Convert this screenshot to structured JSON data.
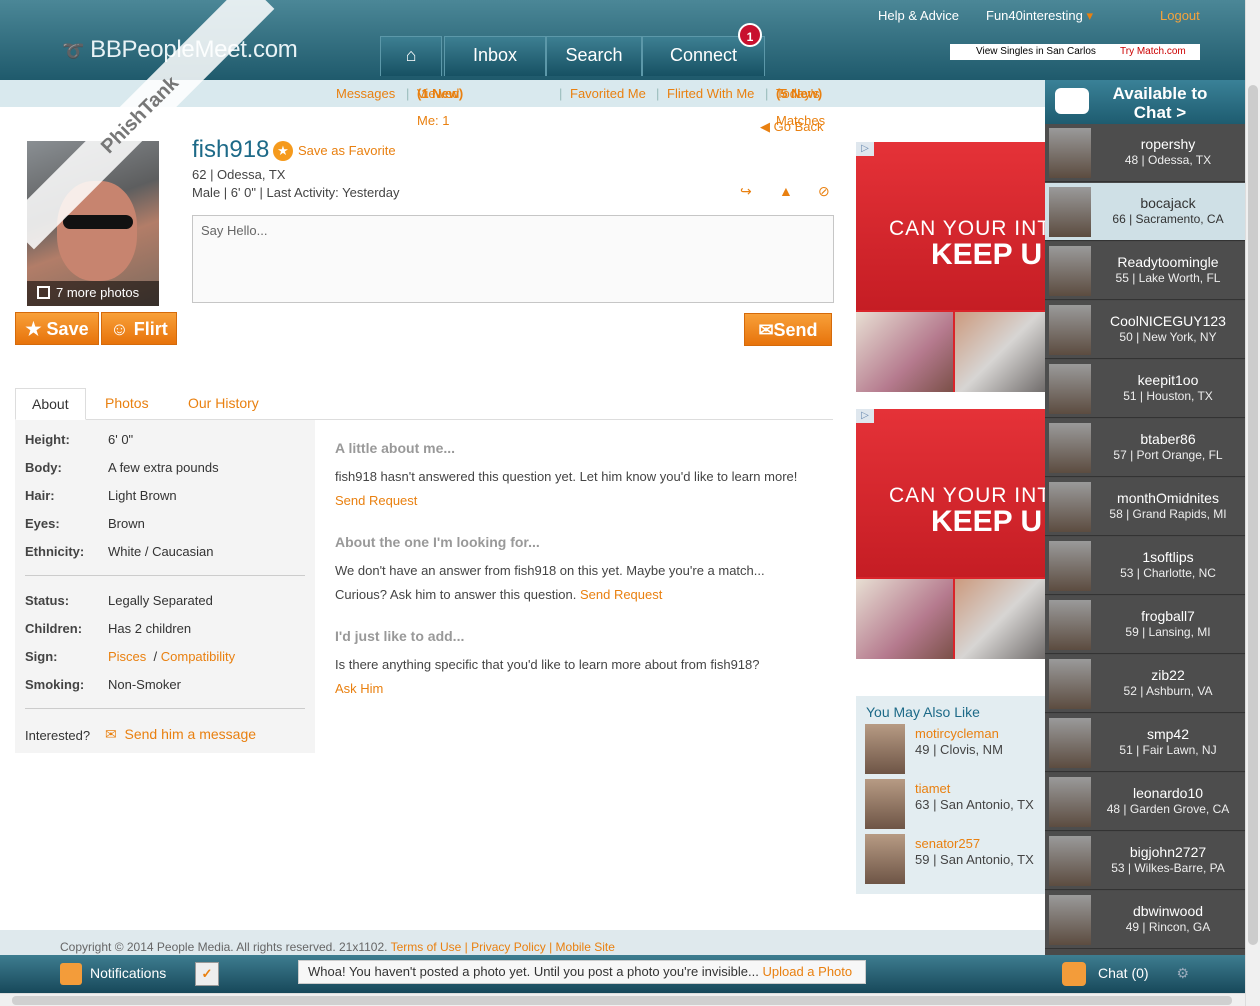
{
  "header": {
    "logo": "BBPeopleMeet.com",
    "nav": [
      "Inbox",
      "Search",
      "Connect"
    ],
    "connect_badge": "1",
    "help": "Help & Advice",
    "fun": "Fun40interesting",
    "logout": "Logout",
    "promo_left": "View Singles in San Carlos",
    "promo_right": "Try Match.com"
  },
  "subnav": {
    "messages": "Messages",
    "viewed": "Viewed Me: 1",
    "viewed_new": "(1 New)",
    "favorited": "Favorited Me",
    "flirted": "Flirted With Me",
    "matches": "Today's Matches",
    "matches_new": "(5 New)"
  },
  "profile": {
    "username": "fish918",
    "save_fav": "Save as Favorite",
    "location": "62 | Odessa, TX",
    "stats": "Male | 6' 0\" | Last Activity: Yesterday",
    "more_photos": "7 more photos",
    "save_btn": "Save",
    "flirt_btn": "Flirt",
    "send_btn": "Send",
    "go_back": "Go Back",
    "say_hello": "Say Hello..."
  },
  "tabs": [
    "About",
    "Photos",
    "Our History"
  ],
  "about": {
    "rows": [
      {
        "label": "Height:",
        "value": "6' 0\""
      },
      {
        "label": "Body:",
        "value": "A few extra pounds"
      },
      {
        "label": "Hair:",
        "value": "Light Brown"
      },
      {
        "label": "Eyes:",
        "value": "Brown"
      },
      {
        "label": "Ethnicity:",
        "value": "White / Caucasian"
      },
      {
        "label": "Status:",
        "value": "Legally Separated"
      },
      {
        "label": "Children:",
        "value": "Has 2 children"
      },
      {
        "label": "Sign:",
        "value": "Pisces"
      },
      {
        "label": "Smoking:",
        "value": "Non-Smoker"
      }
    ],
    "compat": "Compatibility",
    "interested": "Interested?",
    "send_message": "Send him a message"
  },
  "qa": {
    "h1": "A little about me...",
    "t1": "fish918 hasn't answered this question yet. Let him know you'd like to learn more!",
    "l1": "Send Request",
    "h2": "About the one I'm looking for...",
    "t2": "We don't have an answer from fish918 on this yet. Maybe you're a match... Curious? Ask him to answer this question.",
    "l2": "Send Request",
    "h3": "I'd just like to add...",
    "t3": "Is there anything specific that you'd like to learn more about from fish918?",
    "l3": "Ask Him"
  },
  "ads": {
    "line1": "CAN YOUR INT",
    "line2": "KEEP U"
  },
  "ymal": {
    "title": "You May Also Like",
    "people": [
      {
        "name": "motircycleman",
        "loc": "49 | Clovis, NM"
      },
      {
        "name": "tiamet",
        "loc": "63 | San Antonio, TX"
      },
      {
        "name": "senator257",
        "loc": "59 | San Antonio, TX"
      }
    ]
  },
  "chat": {
    "title": "Available to Chat  >",
    "users": [
      {
        "name": "ropershy",
        "loc": "48 | Odessa, TX"
      },
      {
        "name": "bocajack",
        "loc": "66 | Sacramento, CA"
      },
      {
        "name": "Readytoomingle",
        "loc": "55 | Lake Worth, FL"
      },
      {
        "name": "CoolNICEGUY123",
        "loc": "50 | New York, NY"
      },
      {
        "name": "keepit1oo",
        "loc": "51 | Houston, TX"
      },
      {
        "name": "btaber86",
        "loc": "57 | Port Orange, FL"
      },
      {
        "name": "monthOmidnites",
        "loc": "58 | Grand Rapids, MI"
      },
      {
        "name": "1softlips",
        "loc": "53 | Charlotte, NC"
      },
      {
        "name": "frogball7",
        "loc": "59 | Lansing, MI"
      },
      {
        "name": "zib22",
        "loc": "52 | Ashburn, VA"
      },
      {
        "name": "smp42",
        "loc": "51 | Fair Lawn, NJ"
      },
      {
        "name": "leonardo10",
        "loc": "48 | Garden Grove, CA"
      },
      {
        "name": "bigjohn2727",
        "loc": "53 | Wilkes-Barre, PA"
      },
      {
        "name": "dbwinwood",
        "loc": "49 | Rincon, GA"
      }
    ]
  },
  "footer": {
    "text": "Copyright © 2014 People Media. All rights reserved. 21x1102.",
    "links": "Terms of Use | Privacy Policy | Mobile Site"
  },
  "bottombar": {
    "notifications": "Notifications",
    "warning": "Whoa! You haven't posted a photo yet. Until you post a photo you're invisible...",
    "upload": "Upload a Photo",
    "chat": "Chat (0)"
  },
  "watermark": "PhishTank"
}
